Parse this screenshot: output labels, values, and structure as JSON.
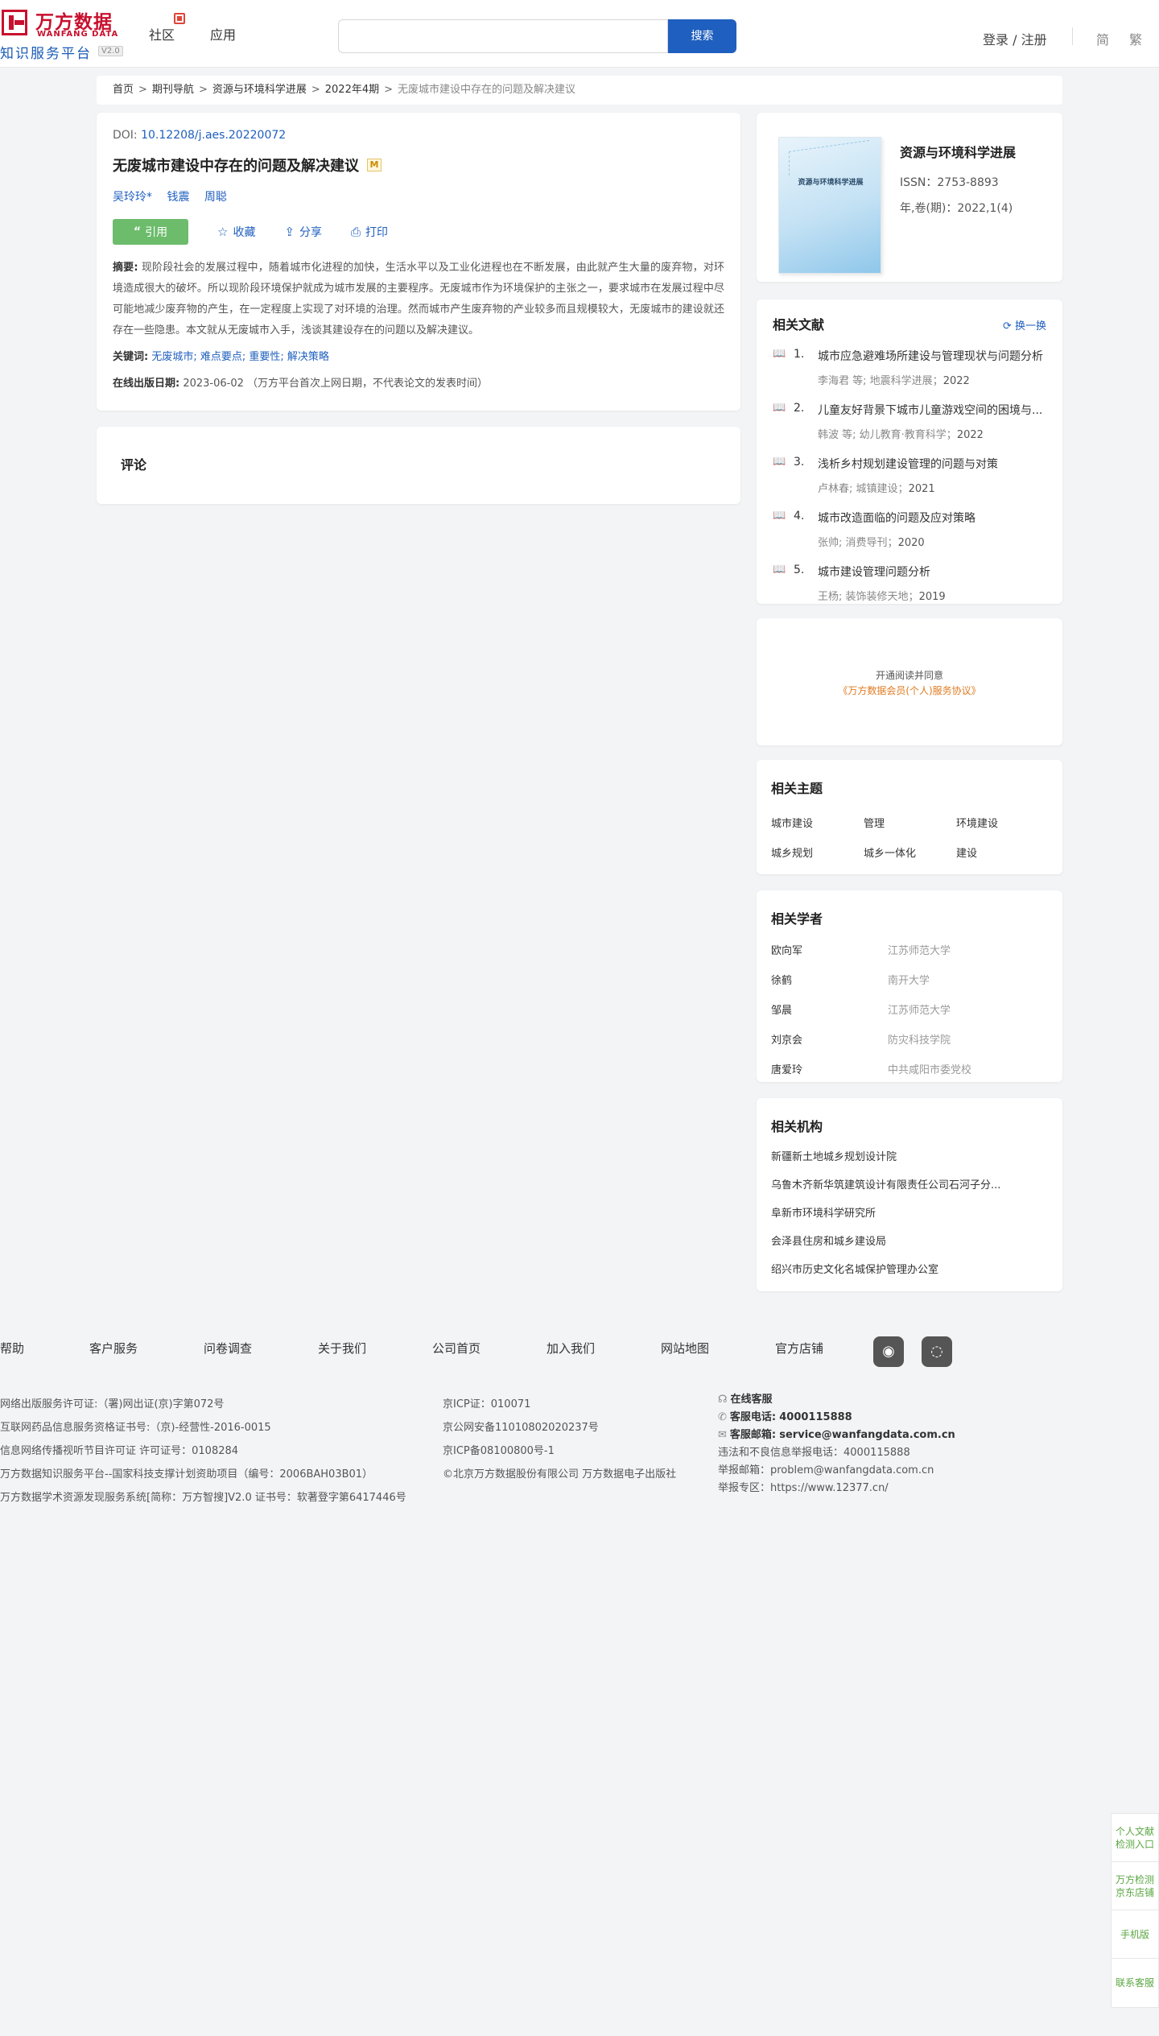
{
  "header": {
    "logo_cn": "万方数据",
    "logo_en": "WANFANG DATA",
    "logo_sub": "知识服务平台",
    "logo_version": "V2.0",
    "nav": [
      "社区",
      "应用"
    ],
    "search_placeholder": "",
    "search_button": "搜索",
    "login": "登录 / 注册",
    "lang_simplified": "简",
    "lang_traditional": "繁"
  },
  "breadcrumb": {
    "items": [
      "首页",
      "期刊导航",
      "资源与环境科学进展",
      "2022年4期"
    ],
    "current": "无废城市建设中存在的问题及解决建议"
  },
  "article": {
    "doi_label": "DOI:",
    "doi": "10.12208/j.aes.20220072",
    "title": "无废城市建设中存在的问题及解决建议",
    "badge": "M",
    "authors": [
      "吴玲玲*",
      "钱震",
      "周聪"
    ],
    "cite": "引用",
    "collect": "收藏",
    "share": "分享",
    "print": "打印",
    "abstract_label": "摘要:",
    "abstract": "现阶段社会的发展过程中，随着城市化进程的加快，生活水平以及工业化进程也在不断发展，由此就产生大量的废弃物，对环境造成很大的破坏。所以现阶段环境保护就成为城市发展的主要程序。无废城市作为环境保护的主张之一，要求城市在发展过程中尽可能地减少废弃物的产生，在一定程度上实现了对环境的治理。然而城市产生废弃物的产业较多而且规模较大，无废城市的建设就还存在一些隐患。本文就从无废城市入手，浅谈其建设存在的问题以及解决建议。",
    "keywords_label": "关键词:",
    "keywords": "无废城市; 难点要点; 重要性; 解决策略",
    "pubdate_label": "在线出版日期:",
    "pubdate": "2023-06-02",
    "pubdate_note": "（万方平台首次上网日期，不代表论文的发表时间）"
  },
  "comment": {
    "title": "评论"
  },
  "journal": {
    "cover_title": "资源与环境科学进展",
    "name": "资源与环境科学进展",
    "issn": "ISSN：2753-8893",
    "volume": "年,卷(期)：2022,1(4)"
  },
  "related_docs": {
    "title": "相关文献",
    "refresh": "换一换",
    "items": [
      {
        "num": "1.",
        "title": "城市应急避难场所建设与管理现状与问题分析",
        "authors": "李海君 等;",
        "source": "地震科学进展",
        "year": "2022"
      },
      {
        "num": "2.",
        "title": "儿童友好背景下城市儿童游戏空间的困境与...",
        "authors": "韩波 等;",
        "source": "幼儿教育·教育科学",
        "year": "2022"
      },
      {
        "num": "3.",
        "title": "浅析乡村规划建设管理的问题与对策",
        "authors": "卢林春;",
        "source": "城镇建设",
        "year": "2021"
      },
      {
        "num": "4.",
        "title": "城市改造面临的问题及应对策略",
        "authors": "张帅;",
        "source": "消费导刊",
        "year": "2020"
      },
      {
        "num": "5.",
        "title": "城市建设管理问题分析",
        "authors": "王杨;",
        "source": "装饰装修天地",
        "year": "2019"
      }
    ]
  },
  "promo": {
    "line1": "开通阅读并同意",
    "line2": "《万方数据会员(个人)服务协议》"
  },
  "topics": {
    "title": "相关主题",
    "items": [
      "城市建设",
      "管理",
      "环境建设",
      "城乡规划",
      "城乡一体化",
      "建设"
    ]
  },
  "scholars": {
    "title": "相关学者",
    "items": [
      {
        "name": "欧向军",
        "org": "江苏师范大学"
      },
      {
        "name": "徐鹤",
        "org": "南开大学"
      },
      {
        "name": "邹晨",
        "org": "江苏师范大学"
      },
      {
        "name": "刘京会",
        "org": "防灾科技学院"
      },
      {
        "name": "唐爱玲",
        "org": "中共咸阳市委党校"
      }
    ]
  },
  "orgs": {
    "title": "相关机构",
    "items": [
      "新疆新土地城乡规划设计院",
      "乌鲁木齐新华筑建筑设计有限责任公司石河子分...",
      "阜新市环境科学研究所",
      "会泽县住房和城乡建设局",
      "绍兴市历史文化名城保护管理办公室"
    ]
  },
  "footer": {
    "links": [
      "帮助",
      "客户服务",
      "问卷调查",
      "关于我们",
      "公司首页",
      "加入我们",
      "网站地图",
      "官方店铺"
    ],
    "col1": [
      "网络出版服务许可证:（署)网出证(京)字第072号",
      "互联网药品信息服务资格证书号:（京)-经营性-2016-0015",
      "信息网络传播视听节目许可证 许可证号：0108284",
      "万方数据知识服务平台--国家科技支撑计划资助项目（编号：2006BAH03B01）",
      "万方数据学术资源发现服务系统[简称：万方智搜]V2.0 证书号：软著登字第6417446号"
    ],
    "col2": [
      "京ICP证：010071",
      "京公网安备11010802020237号",
      "京ICP备08100800号-1",
      "©北京万方数据股份有限公司 万方数据电子出版社"
    ],
    "online_service": "在线客服",
    "phone_label": "客服电话:",
    "phone": "4000115888",
    "email_label": "客服邮箱:",
    "email": "service@wanfangdata.com.cn",
    "report_phone": "违法和不良信息举报电话：4000115888",
    "report_email": "举报邮箱：problem@wanfangdata.com.cn",
    "report_site": "举报专区：https://www.12377.cn/"
  },
  "float_bar": [
    "个人文献检测入口",
    "万方检测京东店铺",
    "手机版",
    "联系客服"
  ]
}
